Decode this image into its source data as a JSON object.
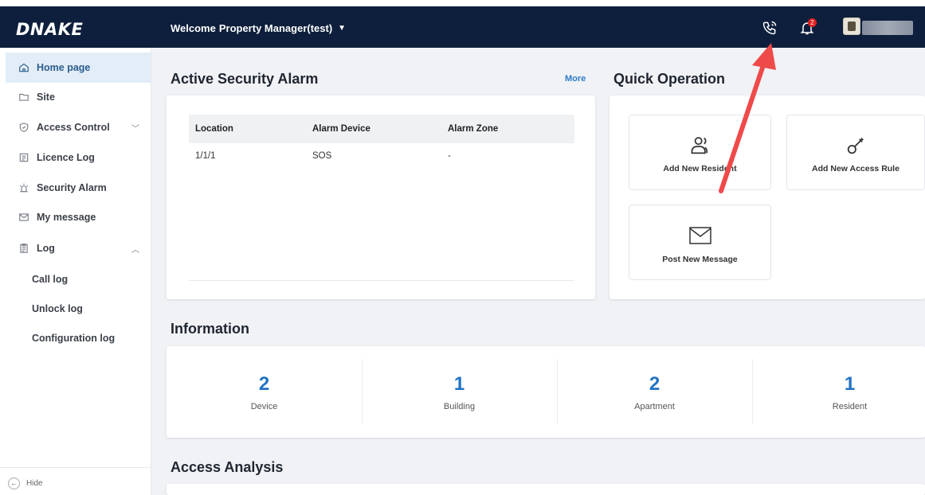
{
  "header": {
    "logo": "DNAKE",
    "welcome_prefix": "Welcome",
    "user_role": "Property Manager(test)",
    "notification_count": "2",
    "icons": [
      "phone-icon",
      "bell-icon",
      "avatar"
    ]
  },
  "sidebar": {
    "items": [
      {
        "label": "Home page",
        "icon": "home-icon",
        "active": true
      },
      {
        "label": "Site",
        "icon": "folder-icon"
      },
      {
        "label": "Access Control",
        "icon": "shield-icon",
        "chevron": "down"
      },
      {
        "label": "Licence Log",
        "icon": "license-icon"
      },
      {
        "label": "Security Alarm",
        "icon": "alarm-icon"
      },
      {
        "label": "My message",
        "icon": "mail-icon"
      },
      {
        "label": "Log",
        "icon": "clipboard-icon",
        "chevron": "up"
      }
    ],
    "log_subitems": [
      "Call log",
      "Unlock log",
      "Configuration log"
    ],
    "hide_label": "Hide"
  },
  "alarm": {
    "title": "Active Security Alarm",
    "more": "More",
    "columns": [
      "Location",
      "Alarm Device",
      "Alarm Zone"
    ],
    "rows": [
      [
        "1/1/1",
        "SOS",
        "-"
      ]
    ]
  },
  "quick": {
    "title": "Quick Operation",
    "items": [
      "Add New Resident",
      "Add New Access Rule",
      "Post New Message"
    ]
  },
  "info": {
    "title": "Information",
    "stats": [
      {
        "value": "2",
        "label": "Device"
      },
      {
        "value": "1",
        "label": "Building"
      },
      {
        "value": "2",
        "label": "Apartment"
      },
      {
        "value": "1",
        "label": "Resident"
      }
    ]
  },
  "analysis": {
    "title": "Access Analysis"
  },
  "colors": {
    "header_bg": "#0d1f3c",
    "accent": "#2273c4",
    "active_nav_bg": "#e3edf7",
    "badge": "#e02020",
    "annotation_arrow": "#ef4a4a"
  }
}
